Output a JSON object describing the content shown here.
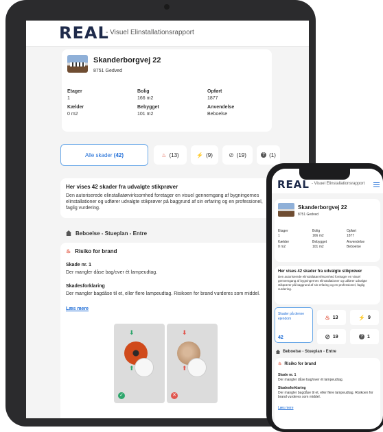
{
  "brand": {
    "logo": "REAL",
    "tagline": "- Visuel Elinstallationsrapport"
  },
  "property": {
    "address": "Skanderborgvej 22",
    "zip_city": "8751 Gedved",
    "fields": [
      {
        "label": "Etager",
        "value": "1"
      },
      {
        "label": "Bolig",
        "value": "166 m2"
      },
      {
        "label": "Opført",
        "value": "1877"
      },
      {
        "label": "Kælder",
        "value": "0 m2"
      },
      {
        "label": "Bebygget",
        "value": "101 m2"
      },
      {
        "label": "Anvendelse",
        "value": "Beboelse"
      }
    ]
  },
  "filters": {
    "all_label": "Alle skader",
    "all_count": "(42)",
    "fire_count": "(13)",
    "electric_count": "(9)",
    "none_count": "(19)",
    "unknown_count": "(1)"
  },
  "info": {
    "title": "Her vises 42 skader fra udvalgte stikprøver",
    "body": "Den autoriserede elinstallatørvirksomhed foretager en visuel gennemgang af bygningernes elinstallationer og udfører udvalgte stikprøver på baggrund af sin erfaring og en professionel, faglig vurdering."
  },
  "section": {
    "title": "Beboelse - Stueplan - Entre"
  },
  "risk": {
    "title": "Risiko for brand",
    "damage_label": "Skade nr. 1",
    "damage_text": "Der mangler dåse bag/over ét lampeudtag.",
    "explanation_label": "Skadesforklaring",
    "explanation_text": "Der mangler bagdåse til et, eller flere lampeudtag. Risikoen for brand vurderes som middel.",
    "read_more": "Læs mere"
  },
  "phone": {
    "tagline": "- Visuel Elinstallationsrapport",
    "filter_all_label": "Skader på denne ejendom",
    "filter_all_count": "42",
    "fire_count": "13",
    "electric_count": "9",
    "none_count": "19",
    "unknown_count": "1"
  },
  "colors": {
    "accent": "#1a6ad6",
    "fire": "#e0503a",
    "electric": "#f2a81b",
    "ok": "#2ea66c",
    "bad": "#e0564e",
    "brand": "#1e2a4a"
  }
}
